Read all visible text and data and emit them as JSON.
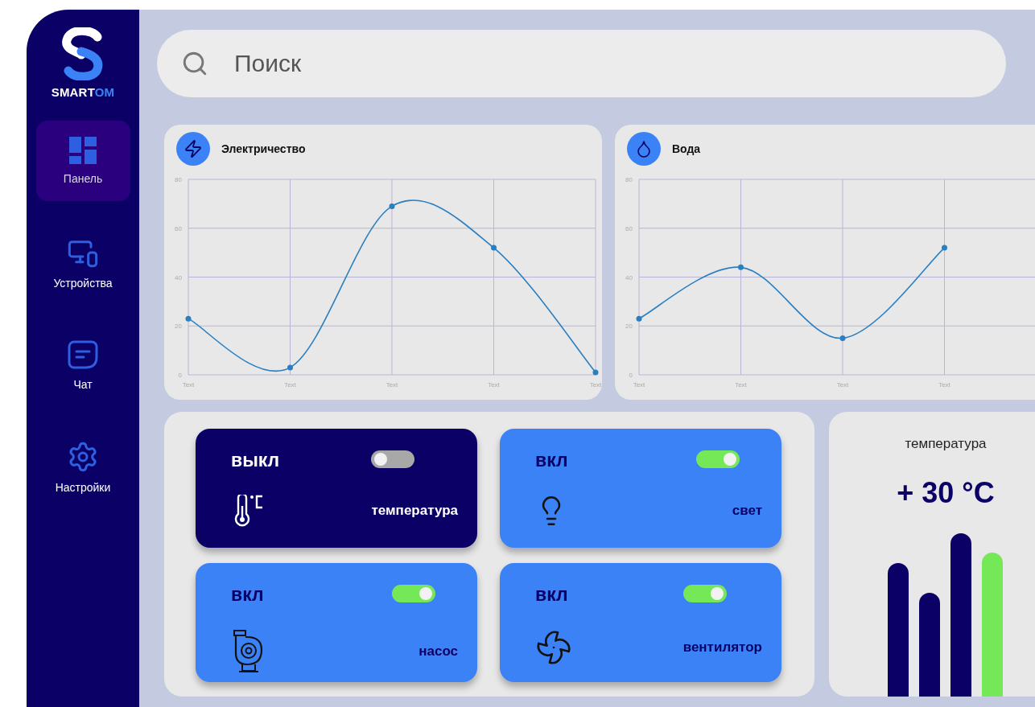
{
  "logo": {
    "name_start": "SMART",
    "name_end": "OM"
  },
  "sidebar": {
    "items": [
      {
        "label": "Панель",
        "kind": "dashboard",
        "selected": true
      },
      {
        "label": "Устройства",
        "kind": "devices",
        "selected": false
      },
      {
        "label": "Чат",
        "kind": "chat",
        "selected": false
      },
      {
        "label": "Настройки",
        "kind": "settings",
        "selected": false
      }
    ]
  },
  "search": {
    "placeholder": "Поиск"
  },
  "charts": [
    {
      "title": "Электричество",
      "kind": "power",
      "chart_data": {
        "type": "line",
        "categories": [
          "Text",
          "Text",
          "Text",
          "Text",
          "Text"
        ],
        "series": [
          {
            "color": "#2a7fc1",
            "marker": true,
            "values": [
              23,
              3,
              69,
              52,
              1
            ]
          }
        ],
        "grid": true,
        "ylim": [
          0,
          80
        ],
        "yticks": [
          0,
          20,
          40,
          60,
          80
        ]
      }
    },
    {
      "title": "Вода",
      "kind": "water",
      "chart_data": {
        "type": "line",
        "categories": [
          "Text",
          "Text",
          "Text",
          "Text"
        ],
        "series": [
          {
            "color": "#2a7fc1",
            "marker": true,
            "values": [
              23,
              44,
              15,
              52
            ]
          }
        ],
        "grid": true,
        "ylim": [
          0,
          80
        ],
        "yticks": [
          0,
          20,
          40,
          60,
          80
        ]
      }
    }
  ],
  "devices": [
    {
      "status": "выкл",
      "on": false,
      "label": "температура",
      "kind": "thermometer"
    },
    {
      "status": "вкл",
      "on": true,
      "label": "свет",
      "kind": "bulb"
    },
    {
      "status": "вкл",
      "on": true,
      "label": "насос",
      "kind": "pump"
    },
    {
      "status": "вкл",
      "on": true,
      "label": "вентилятор",
      "kind": "fan"
    }
  ],
  "temperature": {
    "title": "температура",
    "value": "+ 30 °C"
  }
}
